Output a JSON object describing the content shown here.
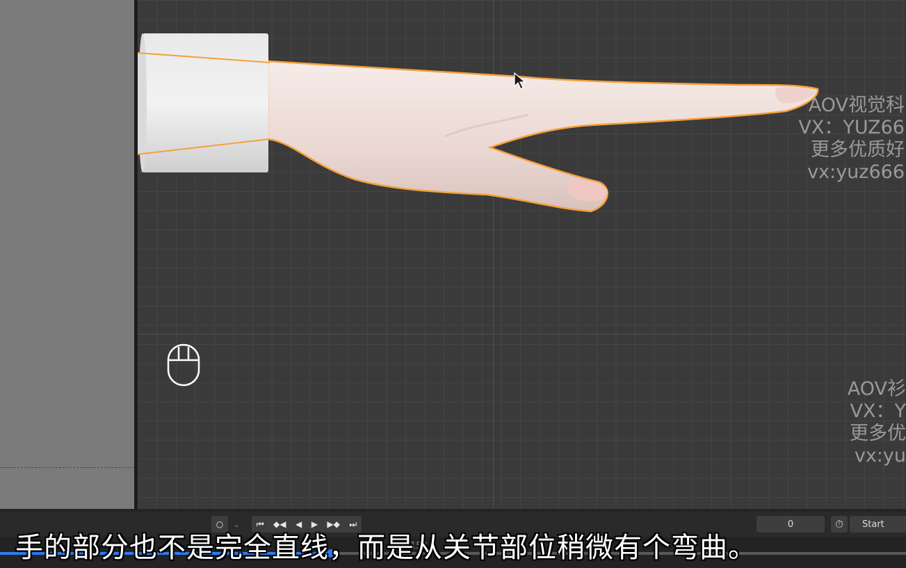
{
  "watermarks": [
    {
      "lines": [
        "AOV视觉科",
        "VX：YUZ66",
        "更多优质好",
        "vx:yuz666"
      ]
    },
    {
      "lines": [
        "AOV衫",
        "VX：Y",
        "更多优",
        "vx:yu"
      ]
    }
  ],
  "playback": {
    "record_icon": "circle-icon",
    "dropdown_icon": "chevron-down-icon",
    "jump_start_icon": "jump-start-icon",
    "prev_key_icon": "prev-keyframe-icon",
    "play_reverse_icon": "play-reverse-icon",
    "play_icon": "play-icon",
    "next_key_icon": "next-keyframe-icon",
    "jump_end_icon": "jump-end-icon"
  },
  "timeline": {
    "current_frame": "0",
    "start_label": "Start",
    "frame_marker": "150"
  },
  "subtitle": "手的部分也不是完全直线，而是从关节部位稍微有个弯曲。",
  "video": {
    "progress": 0.365
  },
  "colors": {
    "selection_outline": "#f5a03a",
    "progress": "#2d7cf6"
  }
}
